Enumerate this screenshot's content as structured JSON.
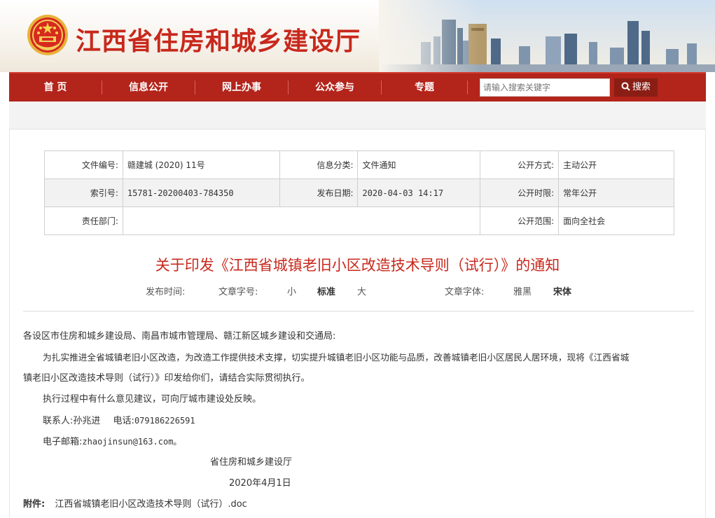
{
  "header": {
    "site_title": "江西省住房和城乡建设厅"
  },
  "nav": {
    "items": [
      "首 页",
      "信息公开",
      "网上办事",
      "公众参与",
      "专题"
    ],
    "search_placeholder": "请输入搜索关键字",
    "search_button": "搜索"
  },
  "info": {
    "doc_no_label": "文件编号:",
    "doc_no": "赣建城 (2020) 11号",
    "category_label": "信息分类:",
    "category": "文件通知",
    "method_label": "公开方式:",
    "method": "主动公开",
    "index_label": "索引号:",
    "index": "15781-20200403-784350",
    "date_label": "发布日期:",
    "date": "2020-04-03 14:17",
    "period_label": "公开时限:",
    "period": "常年公开",
    "dept_label": "责任部门:",
    "dept": "",
    "scope_label": "公开范围:",
    "scope": "面向全社会"
  },
  "article": {
    "title": "关于印发《江西省城镇老旧小区改造技术导则（试行）》的通知",
    "meta": {
      "publish_time_label": "发布时间:",
      "font_size_label": "文章字号:",
      "size_small": "小",
      "size_standard": "标准",
      "size_large": "大",
      "font_face_label": "文章字体:",
      "face_yahei": "雅黑",
      "face_songti": "宋体"
    },
    "salutation": "各设区市住房和城乡建设局、南昌市城市管理局、赣江新区城乡建设和交通局:",
    "body_line1": "为扎实推进全省城镇老旧小区改造，为改造工作提供技术支撑，切实提升城镇老旧小区功能与品质，改善城镇老旧小区居民人居环境，现将《江西省城",
    "body_line2": "镇老旧小区改造技术导则（试行）》印发给你们，请结合实际贯彻执行。",
    "feedback": "执行过程中有什么意见建议，可向厅城市建设处反映。",
    "contact_label": "联系人:",
    "contact_name": "孙兆进",
    "phone_label": "电话:",
    "phone": "079186226591",
    "email_label": "电子邮箱:",
    "email": "zhaojinsun@163.com。",
    "signature": "省住房和城乡建设厅",
    "sign_date": "2020年4月1日",
    "attachment_label": "附件:",
    "attachment": "江西省城镇老旧小区改造技术导则（试行）.doc"
  },
  "colors": {
    "brand_red": "#c8281c",
    "nav_red": "#b3241b",
    "search_btn": "#8a1e15"
  }
}
